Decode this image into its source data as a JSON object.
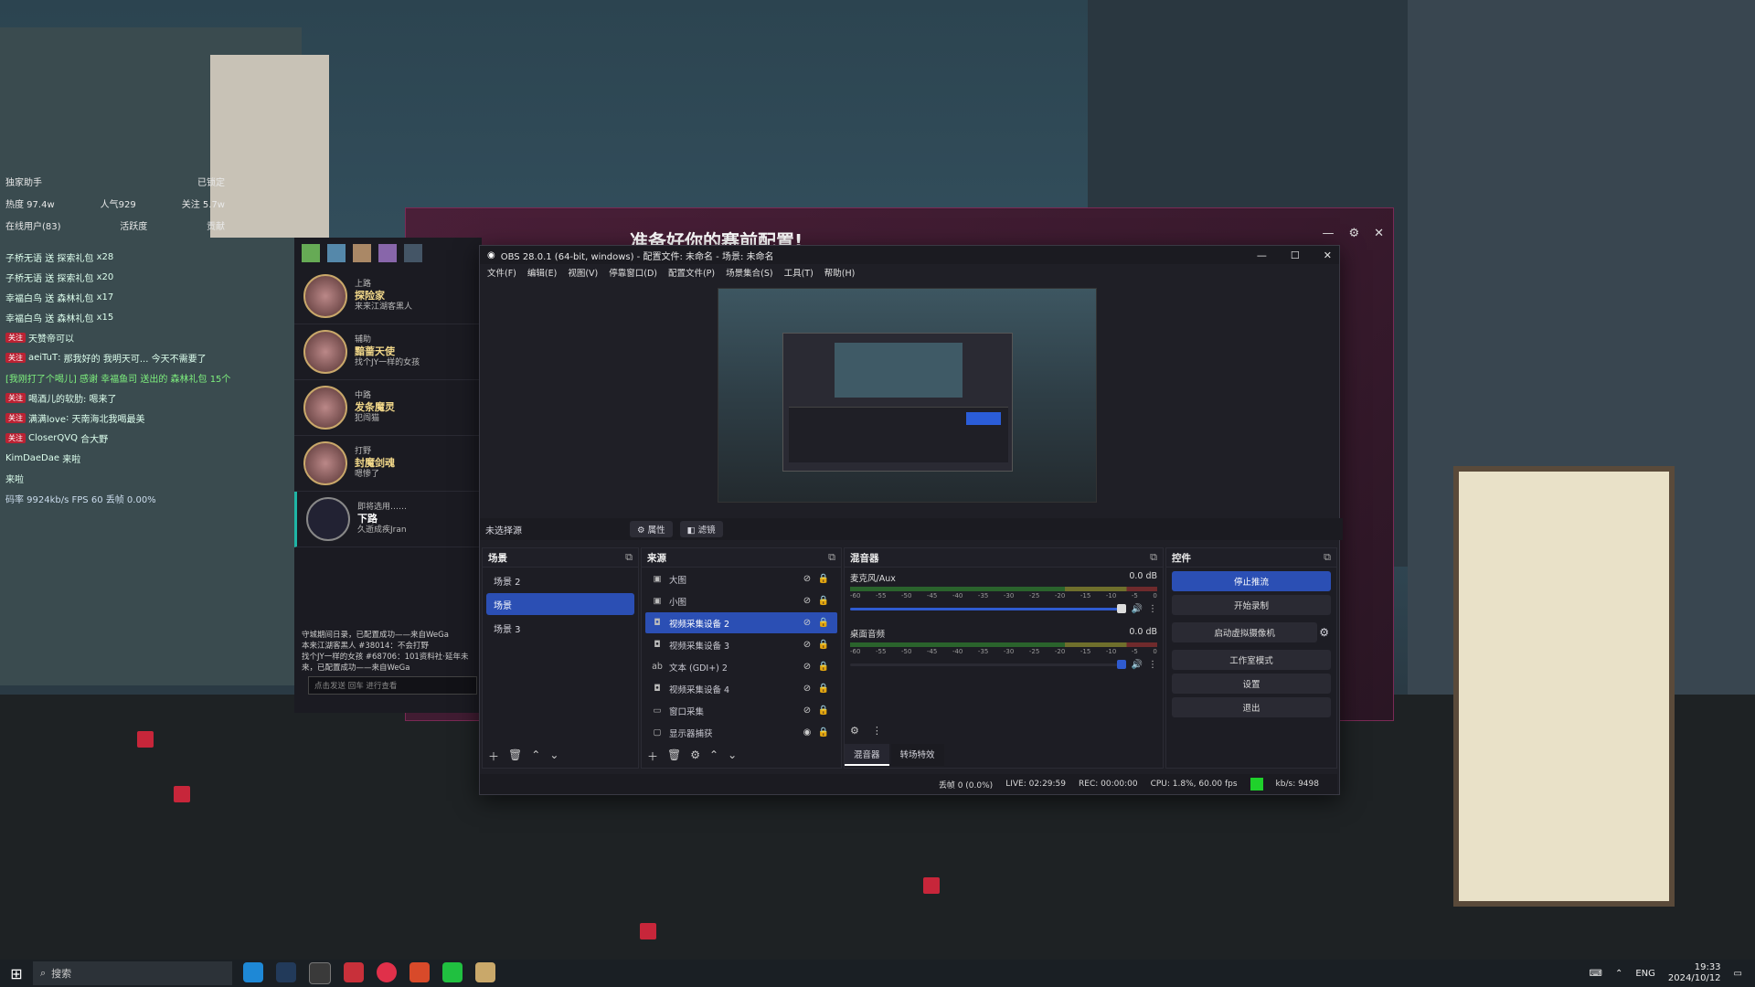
{
  "stream_overlay": {
    "stats": [
      {
        "left": "独家助手",
        "right": "已锁定"
      },
      {
        "left": "热度 97.4w",
        "mid": "人气929",
        "right": "关注 5.7w"
      },
      {
        "left": "在线用户(83)",
        "mid": "活跃度",
        "right": "贡献"
      }
    ],
    "chat_rows": [
      {
        "user": "子桥无语",
        "text": "送 探索礼包",
        "count": "x28"
      },
      {
        "user": "子桥无语",
        "text": "送 探索礼包",
        "count": "x20"
      },
      {
        "user": "幸福白鸟",
        "text": "送 森林礼包",
        "count": "x17"
      },
      {
        "user": "幸福白鸟",
        "text": "送 森林礼包",
        "count": "x15"
      },
      {
        "user": "天赞",
        "text": "天赞帝可以"
      },
      {
        "user": "aeiTuT",
        "text": "那我好的 我明天可... 今天不需要了"
      },
      {
        "user": "",
        "text": "[我刚打了个喝儿] 感谢 幸福鱼司 送出的 森林礼包 15个"
      },
      {
        "user": "喝酒儿",
        "text": "喝酒儿的软肋: 嗯来了"
      },
      {
        "user": "满满love",
        "text": "天南海北我喝最美"
      },
      {
        "user": "CloserQVQ",
        "text": "合大野"
      },
      {
        "user": "KimDaeDae",
        "text": "来啦"
      },
      {
        "user": "",
        "text": "来啦"
      }
    ],
    "footer": "码率 9924kb/s  FPS 60  丢帧 0.00%"
  },
  "game_client": {
    "title": "准备好你的赛前配置!",
    "champions": [
      {
        "role": "上路",
        "name": "探险家",
        "desc": "来来江湖客黑人"
      },
      {
        "role": "辅助",
        "name": "黯蔷天使",
        "desc": "找个JY一样的女孩"
      },
      {
        "role": "中路",
        "name": "发条魔灵",
        "desc": "犯闯猫"
      },
      {
        "role": "打野",
        "name": "封魔剑魂",
        "desc": "嗯惨了"
      },
      {
        "role": "即将选用……",
        "name": "下路",
        "desc": "久逝成疾Jran"
      }
    ],
    "chat_lines": [
      "守城期间日录，已配置成功——来自WeGa",
      "本来江湖客黑人 #38014：不会打野",
      "找个JY一样的女孩 #68706：101资料社·延年未来，已配置成功——来自WeGa"
    ],
    "chat_placeholder": "点击发送 回车 进行查看"
  },
  "obs": {
    "title": "OBS 28.0.1 (64-bit, windows) - 配置文件: 未命名 - 场景: 未命名",
    "menu": [
      "文件(F)",
      "编辑(E)",
      "视图(V)",
      "停靠窗口(D)",
      "配置文件(P)",
      "场景集合(S)",
      "工具(T)",
      "帮助(H)"
    ],
    "no_source_selected": "未选择源",
    "properties_label": "属性",
    "filters_label": "滤镜",
    "scenes_header": "场景",
    "scenes": [
      "场景 2",
      "场景",
      "场景 3"
    ],
    "sources_header": "来源",
    "sources": [
      {
        "icon": "image",
        "name": "大图"
      },
      {
        "icon": "image",
        "name": "小图"
      },
      {
        "icon": "camera",
        "name": "视频采集设备 2"
      },
      {
        "icon": "camera",
        "name": "视频采集设备 3"
      },
      {
        "icon": "text",
        "name": "文本 (GDI+) 2"
      },
      {
        "icon": "camera",
        "name": "视频采集设备 4"
      },
      {
        "icon": "window",
        "name": "窗口采集"
      },
      {
        "icon": "monitor",
        "name": "显示器捕获"
      }
    ],
    "mixer_header": "混音器",
    "mixer_channels": [
      {
        "name": "麦克风/Aux",
        "db": "0.0 dB"
      },
      {
        "name": "桌面音频",
        "db": "0.0 dB"
      }
    ],
    "meter_ticks": [
      "-60",
      "-55",
      "-50",
      "-45",
      "-40",
      "-35",
      "-30",
      "-25",
      "-20",
      "-15",
      "-10",
      "-5",
      "0"
    ],
    "mixer_tabs": [
      "混音器",
      "转场特效"
    ],
    "controls_header": "控件",
    "controls": [
      "停止推流",
      "开始录制",
      "启动虚拟摄像机",
      "工作室模式",
      "设置",
      "退出"
    ],
    "status": {
      "dropped": "丢帧 0 (0.0%)",
      "live": "LIVE: 02:29:59",
      "rec": "REC: 00:00:00",
      "cpu": "CPU: 1.8%, 60.00 fps",
      "kbps": "kb/s: 9498"
    }
  },
  "taskbar": {
    "search_placeholder": "搜索",
    "lang": "ENG",
    "time": "19:33",
    "date": "2024/10/12"
  },
  "colors": {
    "accent": "#2b4fb4",
    "status_green": "#1fd12b"
  }
}
